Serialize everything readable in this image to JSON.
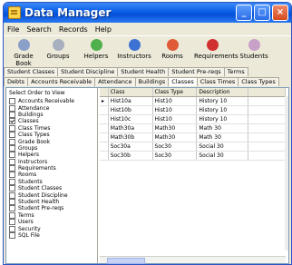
{
  "window": {
    "title": "Data Manager"
  },
  "menu": [
    "File",
    "Search",
    "Records",
    "Help"
  ],
  "toolbar": [
    {
      "label": "Grade Book",
      "color": "#8aa0c8"
    },
    {
      "label": "Groups",
      "color": "#a8b0c0"
    },
    {
      "label": "Helpers",
      "color": "#4fb04c"
    },
    {
      "label": "Instructors",
      "color": "#3d72d4"
    },
    {
      "label": "Rooms",
      "color": "#e05a38"
    },
    {
      "label": "Requirements",
      "color": "#d03030"
    },
    {
      "label": "Students",
      "color": "#c8a0c8"
    }
  ],
  "tabs_row1": [
    "Student Classes",
    "Student Discipline",
    "Student Health",
    "Student Pre-reqs",
    "Terms"
  ],
  "tabs_row2": [
    "Debts",
    "Accounts Receivable",
    "Attendance",
    "Buildings",
    "Classes",
    "Class Times",
    "Class Types"
  ],
  "left_panel": {
    "title": "Select Order to View",
    "items": [
      {
        "label": "Accounts Receivable",
        "checked": false
      },
      {
        "label": "Attendance",
        "checked": false
      },
      {
        "label": "Buildings",
        "checked": false
      },
      {
        "label": "Classes",
        "checked": true
      },
      {
        "label": "Class Times",
        "checked": false
      },
      {
        "label": "Class Types",
        "checked": false
      },
      {
        "label": "Grade Book",
        "checked": false
      },
      {
        "label": "Groups",
        "checked": false
      },
      {
        "label": "Helpers",
        "checked": false
      },
      {
        "label": "Instructors",
        "checked": false
      },
      {
        "label": "Requirements",
        "checked": false
      },
      {
        "label": "Rooms",
        "checked": false
      },
      {
        "label": "Students",
        "checked": false
      },
      {
        "label": "Student Classes",
        "checked": false
      },
      {
        "label": "Student Discipline",
        "checked": false
      },
      {
        "label": "Student Health",
        "checked": false
      },
      {
        "label": "Student Pre-reqs",
        "checked": false
      },
      {
        "label": "Terms",
        "checked": false
      },
      {
        "label": "Users",
        "checked": false
      },
      {
        "label": "Security",
        "checked": false
      },
      {
        "label": "SQL File",
        "checked": false
      }
    ]
  },
  "grid": {
    "columns": [
      "",
      "Class",
      "Class Type",
      "Description",
      ""
    ],
    "rows": [
      [
        "",
        "Hist10a",
        "Hist10",
        "History 10",
        ""
      ],
      [
        "",
        "Hist10b",
        "Hist10",
        "History 10",
        ""
      ],
      [
        "",
        "Hist10c",
        "Hist10",
        "History 10",
        ""
      ],
      [
        "",
        "Math30a",
        "Math30",
        "Math 30",
        ""
      ],
      [
        "",
        "Math30b",
        "Math30",
        "Math 30",
        ""
      ],
      [
        "",
        "Soc30a",
        "Soc30",
        "Social 30",
        ""
      ],
      [
        "",
        "Soc30b",
        "Soc30",
        "Social 30",
        ""
      ]
    ]
  }
}
